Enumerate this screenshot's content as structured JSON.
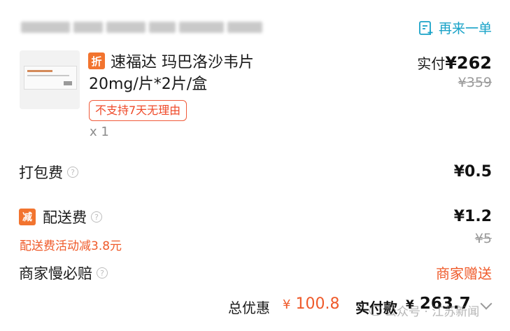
{
  "header": {
    "reorder_label": "再来一单"
  },
  "product": {
    "discount_badge": "折",
    "name_line1": "速福达 玛巴洛沙韦片",
    "name_line2": "20mg/片*2片/盒",
    "return_policy_tag": "不支持7天无理由",
    "quantity": "x 1",
    "paid_label": "实付",
    "paid_amount": "¥262",
    "original_price": "¥359"
  },
  "fees": {
    "packaging_label": "打包费",
    "packaging_amount": "¥0.5",
    "delivery_badge": "减",
    "delivery_label": "配送费",
    "delivery_amount": "¥1.2",
    "delivery_original": "¥5",
    "delivery_promo": "配送费活动减3.8元",
    "merchant_comp_label": "商家慢必赔",
    "merchant_comp_value": "商家赠送"
  },
  "summary": {
    "discount_label": "总优惠",
    "discount_currency": "¥",
    "discount_amount": "100.8",
    "total_label": "实付款",
    "total_currency": "¥",
    "total_amount": "263.7"
  },
  "watermark": {
    "text": "公众号 · 江苏新闻"
  },
  "colors": {
    "accent_orange": "#f2742f",
    "price_red": "#ef5a2a",
    "link_teal": "#1aa3c8"
  }
}
